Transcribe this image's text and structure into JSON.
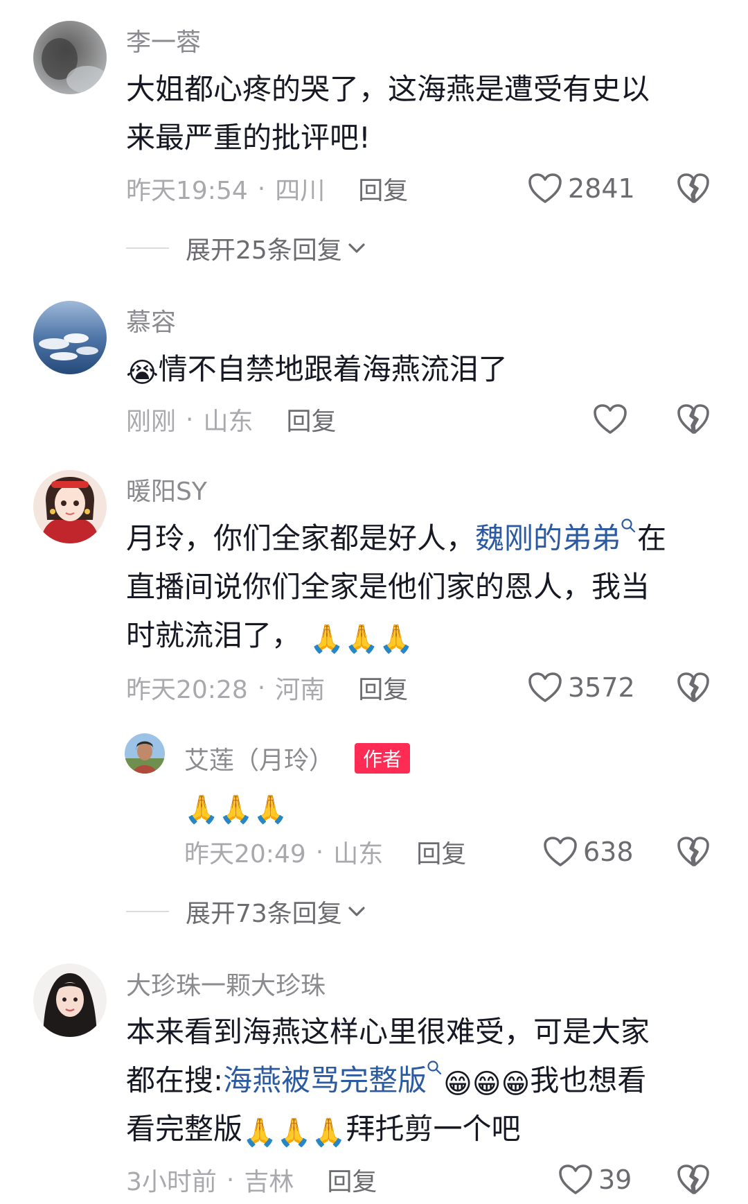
{
  "comments": [
    {
      "user": "李一蓉",
      "text_lines": [
        "大姐都心疼的哭了，这海燕是遭受有史以",
        "来最严重的批评吧!"
      ],
      "time": "昨天19:54",
      "location": "四川",
      "reply_label": "回复",
      "likes": "2841",
      "expand_label": "展开25条回复"
    },
    {
      "user": "慕容",
      "text_emoji": "😭",
      "text": "情不自禁地跟着海燕流泪了",
      "time": "刚刚",
      "location": "山东",
      "reply_label": "回复",
      "likes": ""
    },
    {
      "user": "暖阳SY",
      "line1_a": "月玲，你们全家都是好人，",
      "line1_link": "魏刚的弟弟",
      "line1_b": "在",
      "line2": "直播间说你们全家是他们家的恩人，我当",
      "line3": "时就流泪了，",
      "line3_emojis": "🙏🙏🙏",
      "time": "昨天20:28",
      "location": "河南",
      "reply_label": "回复",
      "likes": "3572",
      "expand_label": "展开73条回复",
      "reply": {
        "user": "艾莲（月玲）",
        "badge": "作者",
        "emojis": "🙏🙏🙏",
        "time": "昨天20:49",
        "location": "山东",
        "reply_label": "回复",
        "likes": "638"
      }
    },
    {
      "user": "大珍珠一颗大珍珠",
      "line1": "本来看到海燕这样心里很难受，可是大家",
      "line2_a": "都在搜:",
      "line2_link": "海燕被骂完整版",
      "line2_emojis": "😁😁😁",
      "line2_b": "我也想看",
      "line3_a": "看完整版",
      "line3_emojis": "🙏🙏🙏",
      "line3_b": "拜托剪一个吧",
      "time": "3小时前",
      "location": "吉林",
      "reply_label": "回复",
      "likes": "39"
    }
  ],
  "icons": {
    "like": "heart-outline-icon",
    "dislike": "broken-heart-icon",
    "expand": "chevron-down-icon",
    "search_link": "search-icon"
  },
  "colors": {
    "link": "#2c5aa0",
    "author_badge": "#fe2c55",
    "meta": "#a8a8ad"
  }
}
